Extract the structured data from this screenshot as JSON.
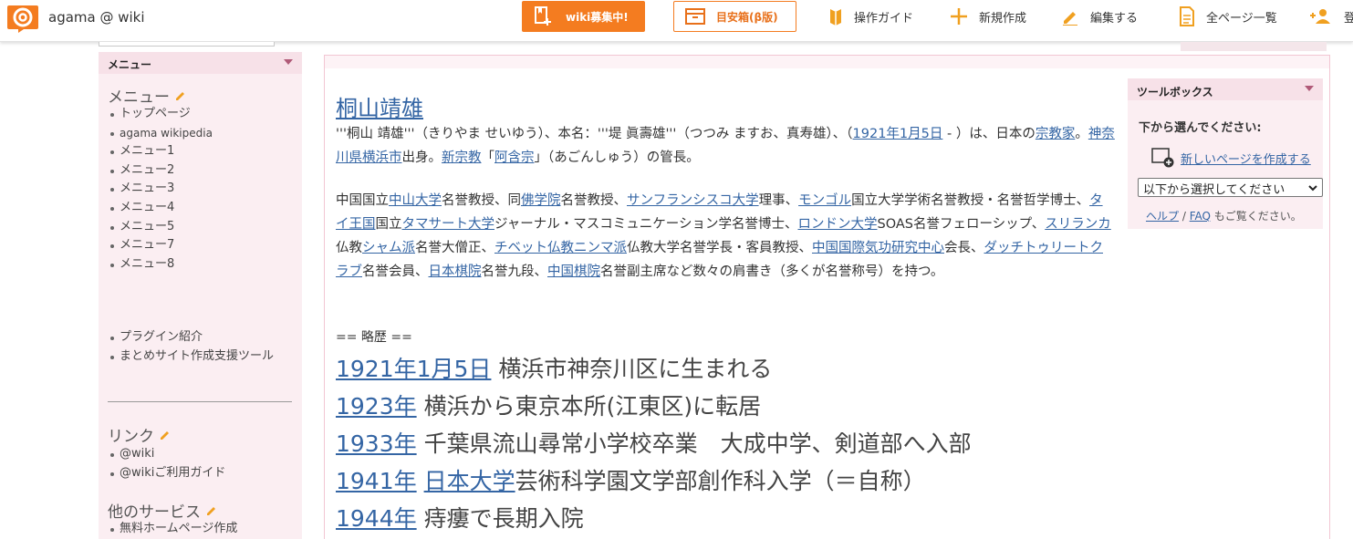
{
  "header": {
    "site_name": "agama @ wiki",
    "recruit_label": "wiki募集中!",
    "mailbox_label": "目安箱(β版)",
    "nav": [
      {
        "label": "操作ガイド"
      },
      {
        "label": "新規作成"
      },
      {
        "label": "編集する"
      },
      {
        "label": "全ページ一覧"
      },
      {
        "label": "登"
      }
    ]
  },
  "sidebar": {
    "title": "メニュー",
    "menu_heading": "メニュー",
    "menu_items": [
      "トップページ",
      "agama wikipedia",
      "メニュー1",
      "メニュー2",
      "メニュー3",
      "メニュー4",
      "メニュー5",
      "メニュー7",
      "メニュー8"
    ],
    "extra_items": [
      "プラグイン紹介",
      "まとめサイト作成支援ツール"
    ],
    "link_heading": "リンク",
    "link_items": [
      "@wiki",
      "@wikiご利用ガイド"
    ],
    "service_heading": "他のサービス",
    "service_items": [
      "無料ホームページ作成"
    ]
  },
  "article": {
    "title": "桐山靖雄",
    "p1": {
      "s1": "'''桐山 靖雄'''（きりやま せいゆう）、本名：'''堤 眞壽雄'''（つつみ ますお、真寿雄）、（",
      "l1": "1921年1月5日",
      "s2": " - ）は、日本の",
      "l2": "宗教家",
      "s3": "。",
      "l3": "神奈川県横浜市",
      "s4": "出身。",
      "l4": "新宗教",
      "s5": "「",
      "l5": "阿含宗",
      "s6": "」（あごんしゅう）の管長。"
    },
    "p2": {
      "s1": "中国国立",
      "l1": "中山大学",
      "s2": "名誉教授、同",
      "l2": "佛学院",
      "s3": "名誉教授、",
      "l3": "サンフランシスコ大学",
      "s4": "理事、",
      "l4": "モンゴル",
      "s5": "国立大学学術名誉教授・名誉哲学博士、",
      "l5": "タイ王国",
      "s6": "国立",
      "l6": "タマサート大学",
      "s7": "ジャーナル・マスコミュニケーション学名誉博士、",
      "l7": "ロンドン大学",
      "s8": "SOAS名誉フェローシップ、",
      "l8": "スリランカ",
      "s9": "仏教",
      "l9": "シャム派",
      "s10": "名誉大僧正、",
      "l10": "チベット仏教ニンマ派",
      "s11": "仏教大学名誉学長・客員教授、",
      "l11": "中国国際気功研究中心",
      "s12": "会長、",
      "l12": "ダッチトゥリートクラブ",
      "s13": "名誉会員、",
      "l13": "日本棋院",
      "s14": "名誉九段、",
      "l14": "中国棋院",
      "s15": "名誉副主席など数々の肩書き（多くが名誉称号）を持つ。"
    },
    "history_label": "== 略歴 ==",
    "history": [
      {
        "year": "1921年1月5日",
        "text": " 横浜市神奈川区に生まれる"
      },
      {
        "year": "1923年",
        "text": " 横浜から東京本所(江東区)に転居"
      },
      {
        "year": "1933年",
        "text": " 千葉県流山尋常小学校卒業　大成中学、剣道部へ入部"
      },
      {
        "year": "1941年",
        "pre": " ",
        "link": "日本大学",
        "text": "芸術科学園文学部創作科入学（＝自称）"
      },
      {
        "year": "1944年",
        "text": " 痔瘻で長期入院"
      }
    ]
  },
  "toolbox": {
    "title": "ツールボックス",
    "label": "下から選んでください:",
    "create_label": "新しいページを作成する",
    "select_value": "以下から選択してください",
    "help_link": "ヘルプ",
    "sep": " / ",
    "faq_link": "FAQ",
    "help_suffix": " もご覧ください。"
  },
  "colors": {
    "accent": "#f47c20",
    "link": "#3465a4",
    "sidebar_bg": "#fbeef2"
  }
}
